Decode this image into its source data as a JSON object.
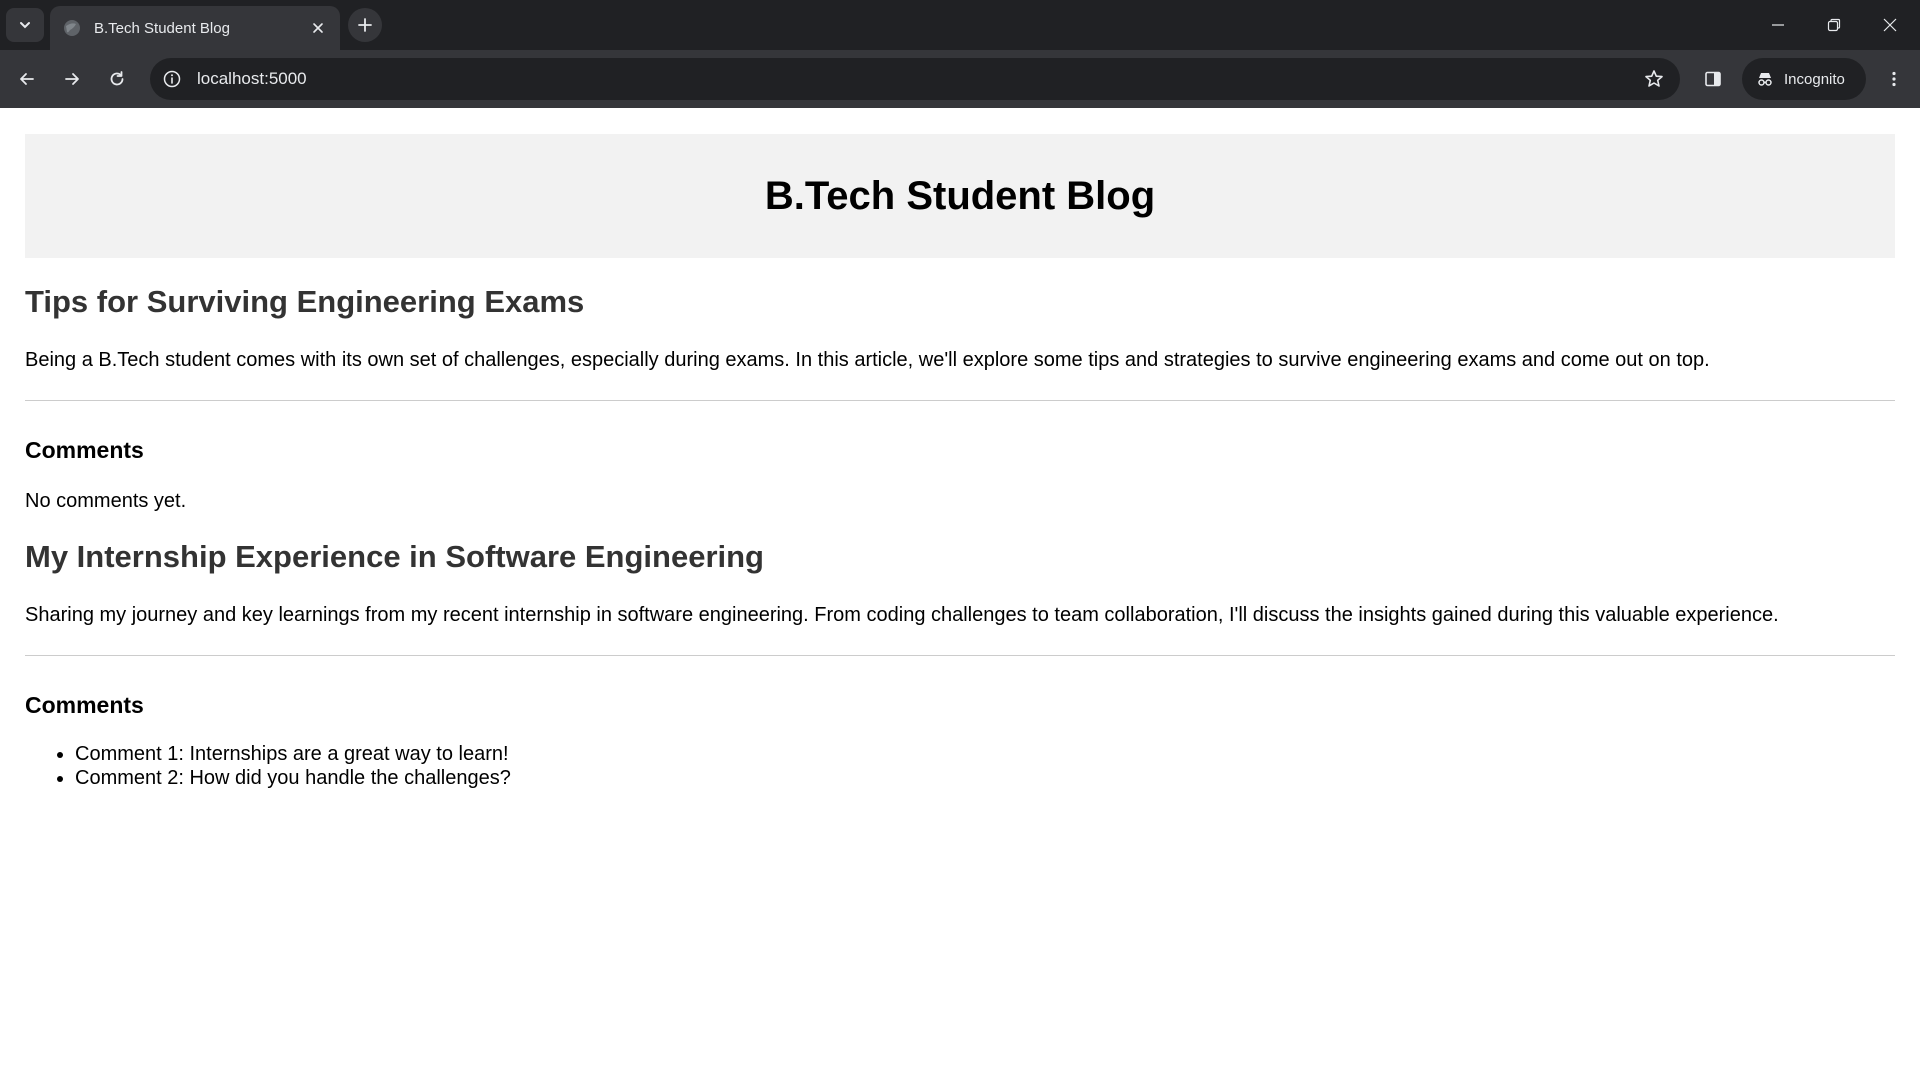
{
  "browser": {
    "tab_title": "B.Tech Student Blog",
    "url": "localhost:5000",
    "incognito_label": "Incognito"
  },
  "site": {
    "title": "B.Tech Student Blog"
  },
  "posts": [
    {
      "title": "Tips for Surviving Engineering Exams",
      "body": "Being a B.Tech student comes with its own set of challenges, especially during exams. In this article, we'll explore some tips and strategies to survive engineering exams and come out on top.",
      "comments_heading": "Comments",
      "empty_text": "No comments yet.",
      "comments": []
    },
    {
      "title": "My Internship Experience in Software Engineering",
      "body": "Sharing my journey and key learnings from my recent internship in software engineering. From coding challenges to team collaboration, I'll discuss the insights gained during this valuable experience.",
      "comments_heading": "Comments",
      "comments": [
        "Comment 1: Internships are a great way to learn!",
        "Comment 2: How did you handle the challenges?"
      ]
    }
  ]
}
